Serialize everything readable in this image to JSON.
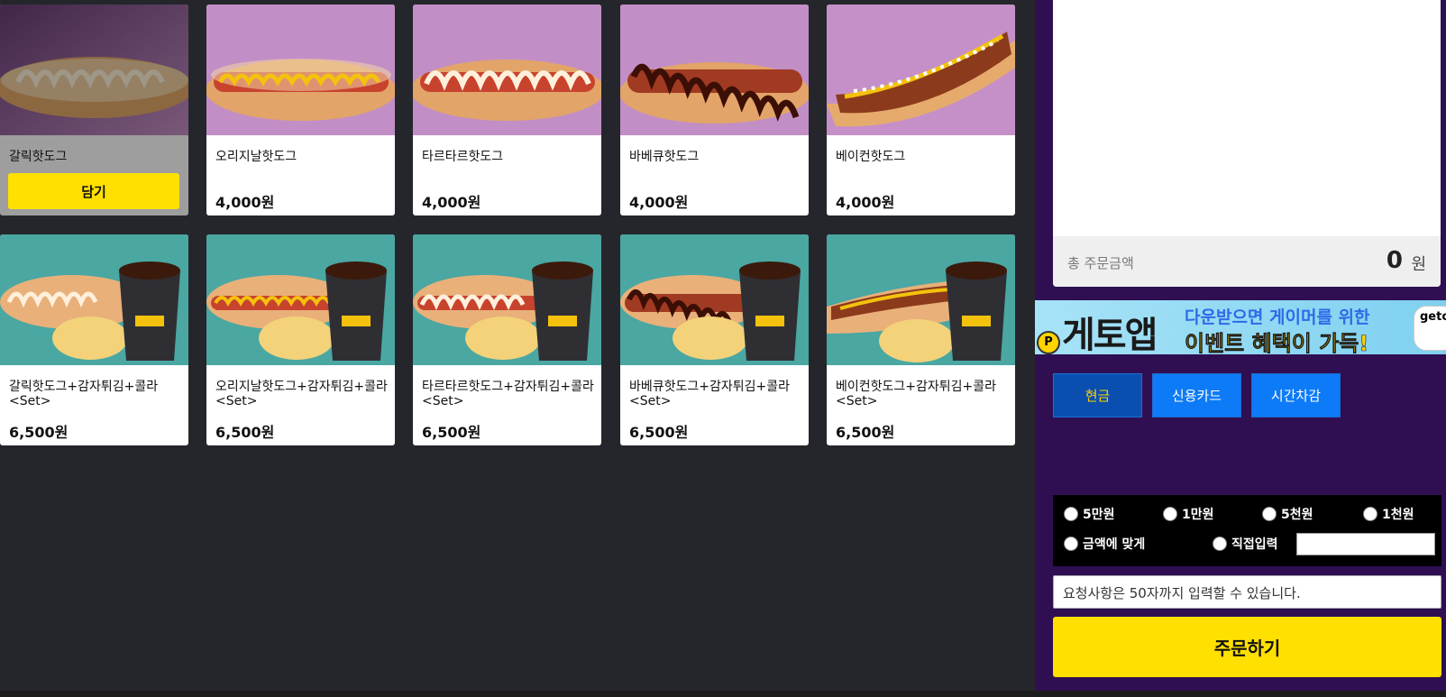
{
  "menu": {
    "add_label": "담기",
    "items": [
      {
        "name": "갈릭핫도그",
        "price": ""
      },
      {
        "name": "오리지날핫도그",
        "price": "4,000원"
      },
      {
        "name": "타르타르핫도그",
        "price": "4,000원"
      },
      {
        "name": "바베큐핫도그",
        "price": "4,000원"
      },
      {
        "name": "베이컨핫도그",
        "price": "4,000원"
      },
      {
        "name": "갈릭핫도그+감자튀김+콜라\n<Set>",
        "price": "6,500원"
      },
      {
        "name": "오리지날핫도그+감자튀김+콜라\n<Set>",
        "price": "6,500원"
      },
      {
        "name": "타르타르핫도그+감자튀김+콜라\n<Set>",
        "price": "6,500원"
      },
      {
        "name": "바베큐핫도그+감자튀김+콜라\n<Set>",
        "price": "6,500원"
      },
      {
        "name": "베이컨핫도그+감자튀김+콜라\n<Set>",
        "price": "6,500원"
      }
    ]
  },
  "cart": {
    "total_label": "총 주문금액",
    "total_amount": "0",
    "total_unit": "원"
  },
  "banner": {
    "brand": "게토앱",
    "line1": "다운받으면 게이머를 위한",
    "line2": "이벤트 혜택이 가득!",
    "badge": "geto",
    "coin": "P"
  },
  "payment": {
    "cash": "현금",
    "card": "신용카드",
    "time": "시간차감"
  },
  "cash_options": {
    "opt1": "5만원",
    "opt2": "1만원",
    "opt3": "5천원",
    "opt4": "1천원",
    "exact": "금액에 맞게",
    "direct": "직접입력"
  },
  "request_placeholder": "요청사항은 50자까지 입력할 수 있습니다.",
  "order_label": "주문하기",
  "colors": {
    "accent_yellow": "#ffe000",
    "panel_purple": "#2f0f52",
    "button_blue": "#0d7bf7"
  }
}
